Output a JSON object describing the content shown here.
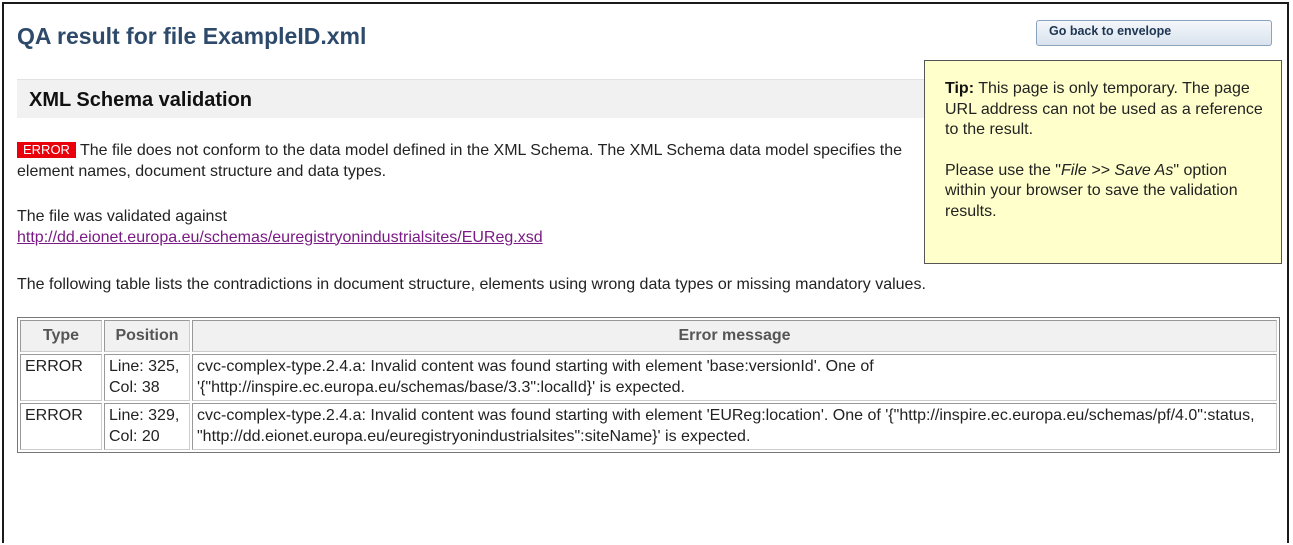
{
  "page": {
    "title": "QA result for file ExampleID.xml",
    "back_button": "Go back to envelope"
  },
  "section": {
    "title": "XML Schema validation"
  },
  "tip": {
    "label": "Tip:",
    "line1": " This page is only temporary. The page URL address can not be used as a reference to the result.",
    "line2_pre": "Please use the \"",
    "line2_em": "File >> Save As",
    "line2_post": "\" option within your browser to save the validation results."
  },
  "result": {
    "badge": "ERROR",
    "message": "The file does not conform to the data model defined in the XML Schema. The XML Schema data model specifies the element names, document structure and data types.",
    "validated_label": "The file was validated against",
    "schema_url": "http://dd.eionet.europa.eu/schemas/euregistryonindustrialsites/EUReg.xsd",
    "intro": "The following table lists the contradictions in document structure, elements using wrong data types or missing mandatory values."
  },
  "table": {
    "headers": [
      "Type",
      "Position",
      "Error message"
    ],
    "rows": [
      {
        "type": "ERROR",
        "position": "Line: 325, Col: 38",
        "message": "cvc-complex-type.2.4.a: Invalid content was found starting with element 'base:versionId'. One of '{\"http://inspire.ec.europa.eu/schemas/base/3.3\":localId}' is expected."
      },
      {
        "type": "ERROR",
        "position": "Line: 329, Col: 20",
        "message": "cvc-complex-type.2.4.a: Invalid content was found starting with element 'EUReg:location'. One of '{\"http://inspire.ec.europa.eu/schemas/pf/4.0\":status, \"http://dd.eionet.europa.eu/euregistryonindustrialsites\":siteName}' is expected."
      }
    ]
  },
  "colors": {
    "title": "#2e4a6b",
    "error_badge": "#e8000b",
    "tip_background": "#ffffcc",
    "link": "#7a1b85"
  }
}
